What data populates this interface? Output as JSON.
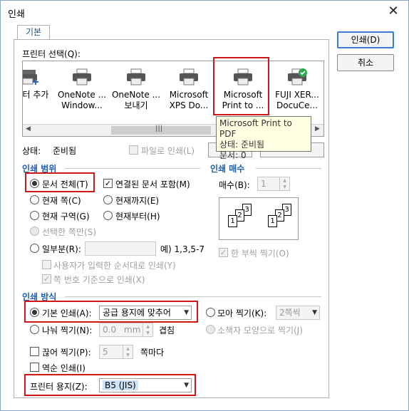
{
  "window": {
    "title": "인쇄",
    "close_icon": "✕"
  },
  "tab": {
    "label": "기본"
  },
  "buttons": {
    "print": "인쇄(D)",
    "cancel": "취소"
  },
  "printer_select": {
    "label": "프린터 선택(Q):",
    "printers": [
      {
        "name_line1": "터 추가",
        "name_line2": ""
      },
      {
        "name_line1": "OneNote ...",
        "name_line2": "Window..."
      },
      {
        "name_line1": "OneNote ...",
        "name_line2": "보내기"
      },
      {
        "name_line1": "Microsoft",
        "name_line2": "XPS Do..."
      },
      {
        "name_line1": "Microsoft",
        "name_line2": "Print to ..."
      },
      {
        "name_line1": "FUJI XER...",
        "name_line2": "DocuCe..."
      }
    ],
    "scroll_thumb": "|||"
  },
  "status": {
    "label": "상태:",
    "value": "준비됨",
    "print_to_file": "파일로 인쇄(L)"
  },
  "tooltip": {
    "line1": "Microsoft Print to PDF",
    "line2": "상태: 준비됨",
    "line3": "문서: 0"
  },
  "range": {
    "title": "인쇄 범위",
    "all_doc": "문서 전체(T)",
    "include_linked": "연결된 문서 포함(M)",
    "current_page": "현재 쪽(C)",
    "to_current": "현재까지(E)",
    "current_section": "현재 구역(G)",
    "from_current": "현재부터(H)",
    "selected_pages": "선택한 쪽만(S)",
    "some_pages": "일부분(R):",
    "example": "예) 1,3,5-7",
    "user_order": "사용자가 입력한 순서대로 인쇄(Y)",
    "page_number_based": "쪽 번호 기준으로 인쇄(X)"
  },
  "copies": {
    "title": "인쇄 매수",
    "count_label": "매수(B):",
    "count_value": "1",
    "collate": "한 부씩 찍기(O)"
  },
  "method": {
    "title": "인쇄 방식",
    "basic": "기본 인쇄(A):",
    "basic_value": "공급 용지에 맞추어",
    "gather": "모아 찍기(K):",
    "gather_value": "2쪽씩",
    "split": "나눠 찍기(N):",
    "split_value": "0.0",
    "split_unit": "mm",
    "overlap": "겹침",
    "booklet": "소책자 모양으로 찍기(J)",
    "cut": "끊어 찍기(P):",
    "cut_value": "5",
    "per_page": "쪽마다",
    "reverse": "역순 인쇄(I)",
    "paper_label": "프린터 용지(Z):",
    "paper_value": "B5 (JIS)"
  }
}
